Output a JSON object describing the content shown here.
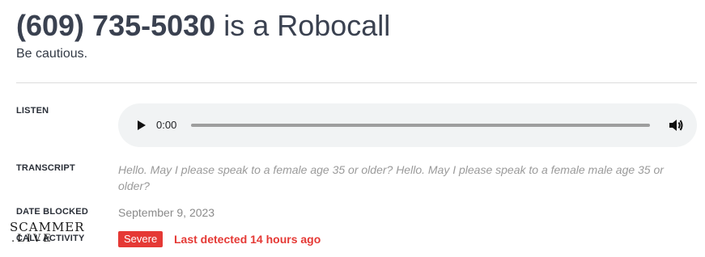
{
  "header": {
    "phone_number": "(609) 735-5030",
    "title_suffix": " is a Robocall",
    "subtitle": "Be cautious."
  },
  "listen": {
    "label": "LISTEN",
    "audio": {
      "current_time": "0:00",
      "progress": 0,
      "play_icon": "play-icon",
      "volume_icon": "volume-icon"
    }
  },
  "transcript": {
    "label": "TRANSCRIPT",
    "text": "Hello. May I please speak to a female age 35 or older? Hello. May I please speak to a female male age 35 or older?"
  },
  "date_blocked": {
    "label": "DATE BLOCKED",
    "value": "September 9, 2023"
  },
  "call_activity": {
    "label": "CALL ACTIVITY",
    "badge": "Severe",
    "detail": "Last detected 14 hours ago"
  },
  "watermark": {
    "line1": "SCAMMER",
    "line2": ".LIVE"
  },
  "colors": {
    "severe": "#e53935",
    "player_bg": "#f1f3f4"
  }
}
